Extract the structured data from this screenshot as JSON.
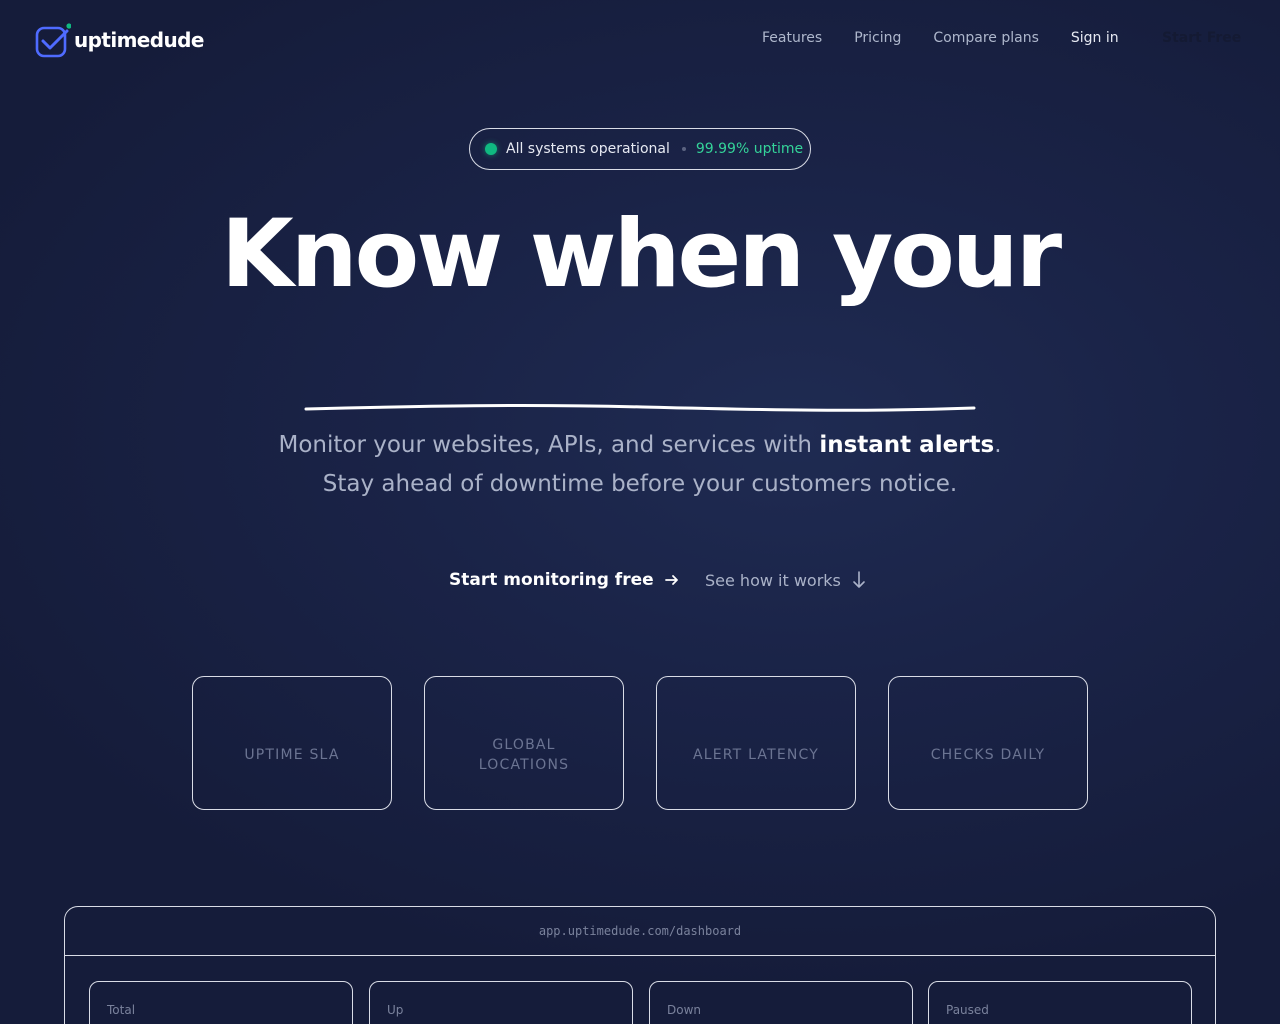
{
  "brand": {
    "name": "uptimedude",
    "accent": "#4f6bff",
    "dot_color": "#10b981"
  },
  "nav": {
    "links": [
      "Features",
      "Pricing",
      "Compare plans"
    ],
    "signin": "Sign in",
    "cta": "Start Free"
  },
  "status": {
    "text": "All systems operational",
    "uptime": "99.99% uptime",
    "color": "#10b981"
  },
  "hero": {
    "title": "Know when your",
    "subtitle_part1": "Monitor your websites, APIs, and services with ",
    "subtitle_emphasis": "instant alerts",
    "subtitle_part2": ". Stay ahead of downtime before your customers notice."
  },
  "ctas": {
    "primary": "Start monitoring free",
    "primary_icon": "arrow-right-icon",
    "secondary": "See how it works",
    "secondary_icon": "arrow-down-icon"
  },
  "stats": [
    {
      "label": "UPTIME SLA"
    },
    {
      "label": "GLOBAL LOCATIONS"
    },
    {
      "label": "ALERT LATENCY"
    },
    {
      "label": "CHECKS DAILY"
    }
  ],
  "dashboard": {
    "url": "app.uptimedude.com/dashboard",
    "cards": [
      "Total",
      "Up",
      "Down",
      "Paused"
    ]
  }
}
